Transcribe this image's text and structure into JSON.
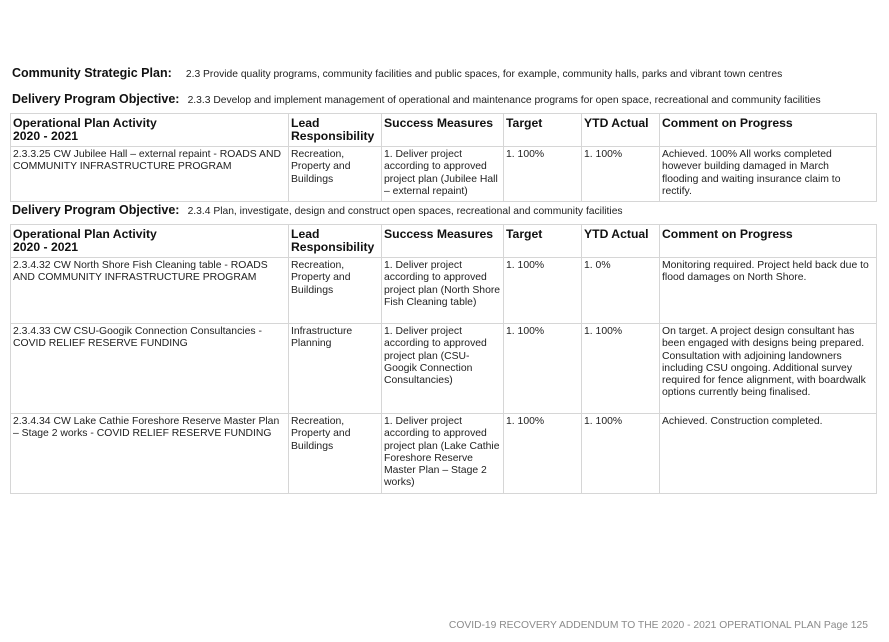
{
  "strategic_plan": {
    "label": "Community Strategic Plan:",
    "text": "2.3 Provide quality programs, community facilities and public spaces, for example, community halls, parks and vibrant town centres"
  },
  "sections": [
    {
      "objective_label": "Delivery Program Objective:",
      "objective_text": "2.3.3 Develop and implement management of operational and maintenance programs for open space, recreational and community facilities",
      "headers": [
        "Operational Plan Activity\n2020 - 2021",
        "Lead Responsibility",
        "Success Measures",
        "Target",
        "YTD Actual",
        "Comment on Progress"
      ],
      "rows": [
        {
          "activity": "2.3.3.25 CW Jubilee Hall – external repaint - ROADS AND COMMUNITY INFRASTRUCTURE PROGRAM",
          "lead": "Recreation, Property and Buildings",
          "measure": "1. Deliver project according to approved project plan (Jubilee Hall – external repaint)",
          "target": "1. 100%",
          "ytd": "1. 100%",
          "comment": "Achieved. 100% All works completed however building damaged in March flooding and waiting insurance claim to rectify."
        }
      ]
    },
    {
      "objective_label": "Delivery Program Objective:",
      "objective_text": "2.3.4 Plan, investigate, design and construct open spaces, recreational and community facilities",
      "headers": [
        "Operational Plan Activity\n2020 - 2021",
        "Lead Responsibility",
        "Success Measures",
        "Target",
        "YTD Actual",
        "Comment on Progress"
      ],
      "rows": [
        {
          "activity": "2.3.4.32 CW North Shore Fish Cleaning table - ROADS AND COMMUNITY INFRASTRUCTURE PROGRAM",
          "lead": "Recreation, Property and Buildings",
          "measure": "1. Deliver project according to approved project plan (North Shore Fish Cleaning table)",
          "target": "1. 100%",
          "ytd": "1. 0%",
          "comment": "Monitoring required. Project held back due to flood damages on North Shore."
        },
        {
          "activity": "2.3.4.33 CW CSU-Googik Connection Consultancies - COVID RELIEF RESERVE FUNDING",
          "lead": "Infrastructure Planning",
          "measure": "1. Deliver project according to approved project plan (CSU-Googik Connection Consultancies)",
          "target": "1. 100%",
          "ytd": "1. 100%",
          "comment": "On target. A project design consultant has been engaged with designs being prepared. Consultation with adjoining landowners including CSU ongoing. Additional survey required for fence alignment, with boardwalk options currently being finalised."
        },
        {
          "activity": "2.3.4.34 CW Lake Cathie Foreshore Reserve Master Plan – Stage 2 works - COVID RELIEF RESERVE FUNDING",
          "lead": "Recreation, Property and Buildings",
          "measure": "1. Deliver project according to approved project plan (Lake Cathie Foreshore Reserve Master Plan – Stage 2 works)",
          "target": "1. 100%",
          "ytd": "1. 100%",
          "comment": "Achieved. Construction completed."
        }
      ]
    }
  ],
  "footer": "COVID-19 RECOVERY ADDENDUM TO THE 2020 - 2021 OPERATIONAL PLAN Page 125"
}
